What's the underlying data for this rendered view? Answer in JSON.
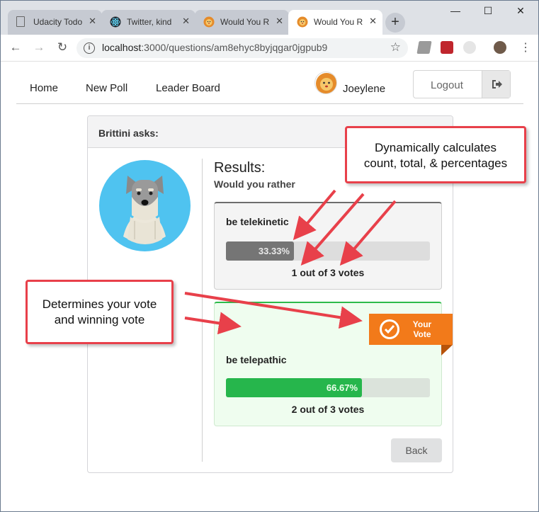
{
  "browser": {
    "tabs": [
      {
        "title": "Udacity Todo",
        "favicon": "document-icon"
      },
      {
        "title": "Twitter, kind",
        "favicon": "react-icon"
      },
      {
        "title": "Would You R",
        "favicon": "lion-icon"
      },
      {
        "title": "Would You R",
        "favicon": "lion-icon",
        "active": true
      }
    ],
    "url_host": "localhost",
    "url_rest": ":3000/questions/am8ehyc8byjqgar0jgpub9"
  },
  "nav": {
    "home": "Home",
    "new_poll": "New Poll",
    "leader_board": "Leader Board",
    "user_name": "Joeylene",
    "logout": "Logout"
  },
  "question": {
    "author_line": "Brittini asks:",
    "results_title": "Results:",
    "subtitle": "Would you rather",
    "options": [
      {
        "text": "be telekinetic",
        "percent_label": "33.33%",
        "fraction": 0.3333,
        "votes_label": "1 out of 3 votes",
        "is_user_vote": false
      },
      {
        "text": "be telepathic",
        "percent_label": "66.67%",
        "fraction": 0.6667,
        "votes_label": "2 out of 3 votes",
        "is_user_vote": true
      }
    ],
    "badge_text_line1": "Your",
    "badge_text_line2": "Vote",
    "back_label": "Back"
  },
  "annotations": {
    "callout1_line1": "Dynamically calculates",
    "callout1_line2": "count, total, & percentages",
    "callout2_line1": "Determines your vote",
    "callout2_line2": "and winning vote"
  },
  "colors": {
    "accent_green": "#26b64c",
    "badge_orange": "#f27a1a",
    "callout_red": "#e8404a",
    "bar_gray": "#757575"
  }
}
